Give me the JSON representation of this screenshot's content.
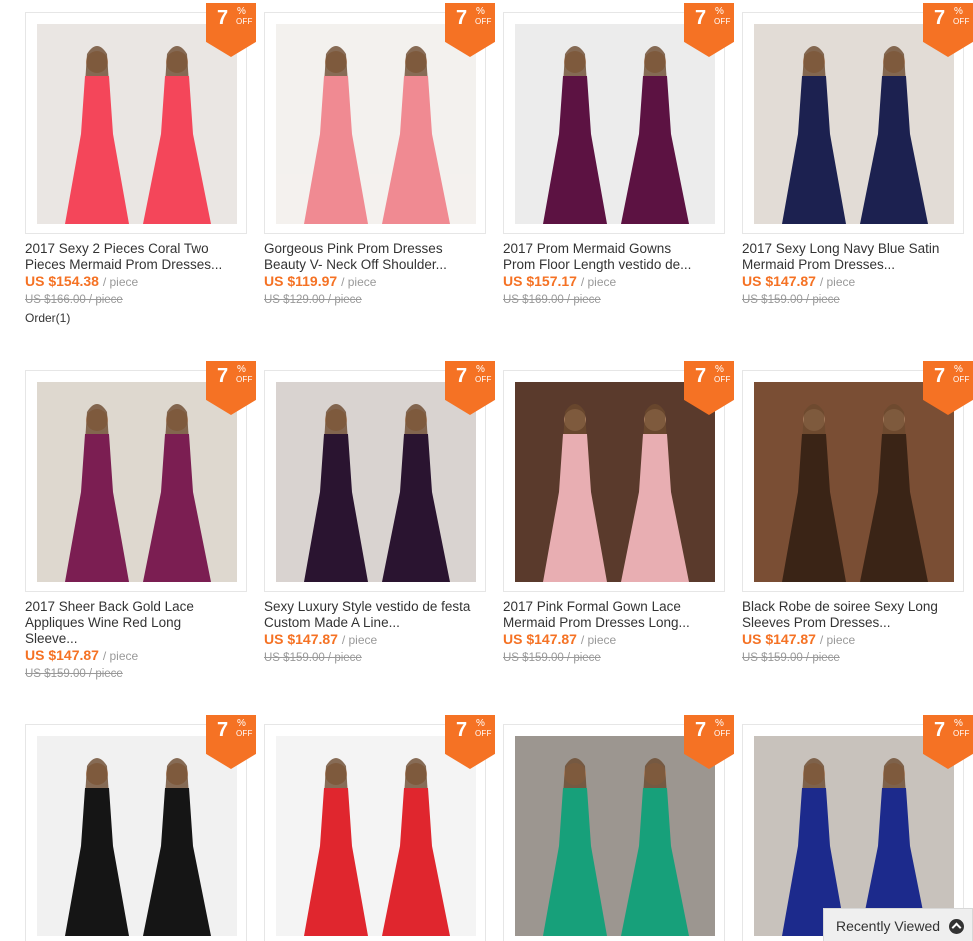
{
  "discount": {
    "number": "7",
    "percent": "%",
    "off": "OFF"
  },
  "products": [
    {
      "title_line1": "2017 Sexy 2 Pieces Coral Two",
      "title_line2": "Pieces Mermaid Prom Dresses...",
      "title_line3": "",
      "price": "US $154.38",
      "unit": "/ piece",
      "old_price": "US $166.00 / piece",
      "orders": "Order(1)",
      "dress_color": "#f4465a",
      "bg_color": "#eae6e3"
    },
    {
      "title_line1": "Gorgeous Pink Prom Dresses",
      "title_line2": "Beauty V- Neck Off Shoulder...",
      "title_line3": "",
      "price": "US $119.97",
      "unit": "/ piece",
      "old_price": "US $129.00 / piece",
      "orders": "",
      "dress_color": "#f08a92",
      "bg_color": "#f3f1ee"
    },
    {
      "title_line1": "2017 Prom Mermaid Gowns",
      "title_line2": "Prom Floor Length vestido de...",
      "title_line3": "",
      "price": "US $157.17",
      "unit": "/ piece",
      "old_price": "US $169.00 / piece",
      "orders": "",
      "dress_color": "#5c1242",
      "bg_color": "#ececec"
    },
    {
      "title_line1": "2017 Sexy Long Navy Blue Satin",
      "title_line2": "Mermaid Prom Dresses...",
      "title_line3": "",
      "price": "US $147.87",
      "unit": "/ piece",
      "old_price": "US $159.00 / piece",
      "orders": "",
      "dress_color": "#1c2150",
      "bg_color": "#e2dcd6"
    },
    {
      "title_line1": "2017 Sheer Back Gold Lace",
      "title_line2": "Appliques Wine Red Long",
      "title_line3": "Sleeve...",
      "price": "US $147.87",
      "unit": "/ piece",
      "old_price": "US $159.00 / piece",
      "orders": "",
      "dress_color": "#7b1e52",
      "bg_color": "#ded8cf"
    },
    {
      "title_line1": "Sexy Luxury Style vestido de festa",
      "title_line2": "Custom Made A Line...",
      "title_line3": "",
      "price": "US $147.87",
      "unit": "/ piece",
      "old_price": "US $159.00 / piece",
      "orders": "",
      "dress_color": "#2a1430",
      "bg_color": "#d9d3d0"
    },
    {
      "title_line1": "2017 Pink Formal Gown Lace",
      "title_line2": "Mermaid Prom Dresses Long...",
      "title_line3": "",
      "price": "US $147.87",
      "unit": "/ piece",
      "old_price": "US $159.00 / piece",
      "orders": "",
      "dress_color": "#e8aeb2",
      "bg_color": "#5a3a2c"
    },
    {
      "title_line1": "Black Robe de soiree Sexy Long",
      "title_line2": "Sleeves Prom Dresses...",
      "title_line3": "",
      "price": "US $147.87",
      "unit": "/ piece",
      "old_price": "US $159.00 / piece",
      "orders": "",
      "dress_color": "#3a2416",
      "bg_color": "#7a4e34"
    },
    {
      "title_line1": "",
      "title_line2": "",
      "title_line3": "",
      "price": "",
      "unit": "",
      "old_price": "",
      "orders": "",
      "dress_color": "#151515",
      "bg_color": "#f1f1f1"
    },
    {
      "title_line1": "",
      "title_line2": "",
      "title_line3": "",
      "price": "",
      "unit": "",
      "old_price": "",
      "orders": "",
      "dress_color": "#e0262e",
      "bg_color": "#f4f4f4"
    },
    {
      "title_line1": "",
      "title_line2": "",
      "title_line3": "",
      "price": "",
      "unit": "",
      "old_price": "",
      "orders": "",
      "dress_color": "#17a07a",
      "bg_color": "#9c9690"
    },
    {
      "title_line1": "",
      "title_line2": "",
      "title_line3": "",
      "price": "",
      "unit": "",
      "old_price": "",
      "orders": "",
      "dress_color": "#1c2a8c",
      "bg_color": "#c8c2bc"
    }
  ],
  "recently_viewed": {
    "label": "Recently Viewed",
    "icon": "chevron-up-icon"
  },
  "colors": {
    "accent": "#f57224",
    "muted": "#999999"
  }
}
